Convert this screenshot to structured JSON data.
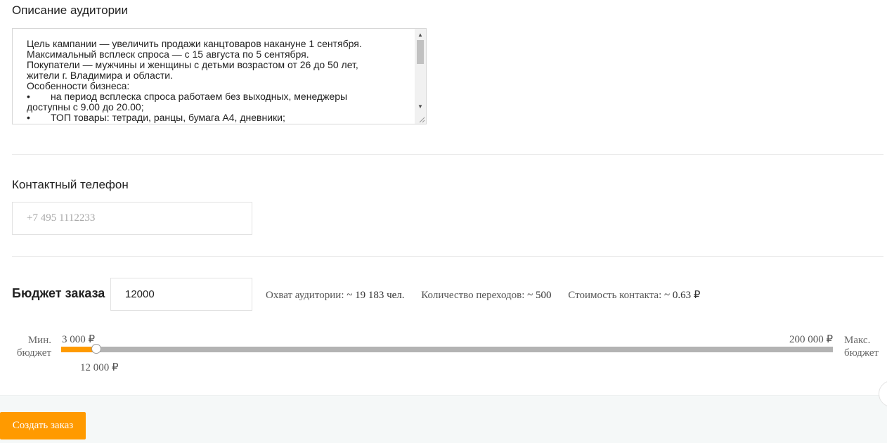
{
  "audience": {
    "title": "Описание аудитории",
    "lines": [
      "Цель кампании — увеличить продажи канцтоваров накануне 1 сентября.",
      "Максимальный всплеск спроса — с 15 августа по 5 сентября.",
      "Покупатели — мужчины и женщины с детьми возрастом от 26 до 50 лет,",
      "жители г. Владимира и области.",
      "Особенности бизнеса:"
    ],
    "bullet_1": "на период всплеска спроса работаем без выходных, менеджеры",
    "bullet_1_cont": "доступны с 9.00 до 20.00;",
    "bullet_2": "ТОП товары: тетради, ранцы, бумага А4, дневники;",
    "bullet_char": "•"
  },
  "phone": {
    "title": "Контактный телефон",
    "placeholder": "+7 495 1112233",
    "value": ""
  },
  "budget": {
    "label": "Бюджет заказа",
    "value": "12000",
    "reach_label": "Охват аудитории:",
    "reach_value": "~ 19 183 чел.",
    "clicks_label": "Количество переходов:",
    "clicks_value": "~ 500",
    "cost_label": "Стоимость контакта:",
    "cost_value": "~ 0.63 ₽"
  },
  "slider": {
    "min_label": "Мин. бюджет",
    "max_label": "Макс. бюджет",
    "min_value_text": "3 000 ₽",
    "max_value_text": "200 000 ₽",
    "current_value_text": "12 000 ₽",
    "min": 3000,
    "max": 200000,
    "value": 12000,
    "accent_color": "#ff9a00"
  },
  "footer": {
    "create_label": "Создать заказ",
    "button_color": "#ff9a00"
  }
}
